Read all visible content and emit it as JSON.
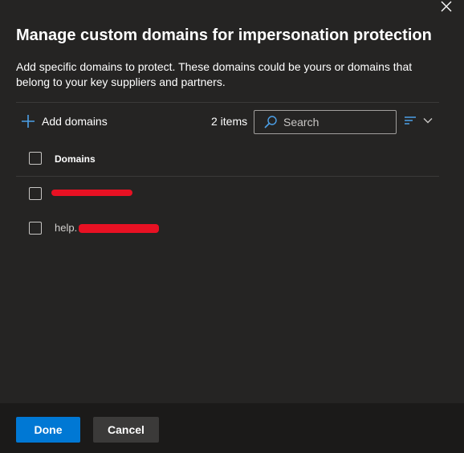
{
  "dialog": {
    "title": "Manage custom domains for impersonation protection",
    "description": "Add specific domains to protect. These domains could be yours or domains that belong to your key suppliers and partners."
  },
  "toolbar": {
    "add_label": "Add domains",
    "item_count": "2 items",
    "search_placeholder": "Search"
  },
  "table": {
    "column_header": "Domains",
    "rows": [
      {
        "domain": ""
      },
      {
        "domain": "help."
      }
    ]
  },
  "footer": {
    "done_label": "Done",
    "cancel_label": "Cancel"
  },
  "colors": {
    "background": "#252423",
    "footer": "#1b1a19",
    "primary_button": "#0078d4",
    "secondary_button": "#3b3a39",
    "accent_icon": "#4ca0e8",
    "redaction": "#e81123"
  },
  "icons": {
    "close": "close-icon",
    "add": "add-icon",
    "search": "search-icon",
    "view": "list-view-icon",
    "chevron": "chevron-down-icon"
  }
}
